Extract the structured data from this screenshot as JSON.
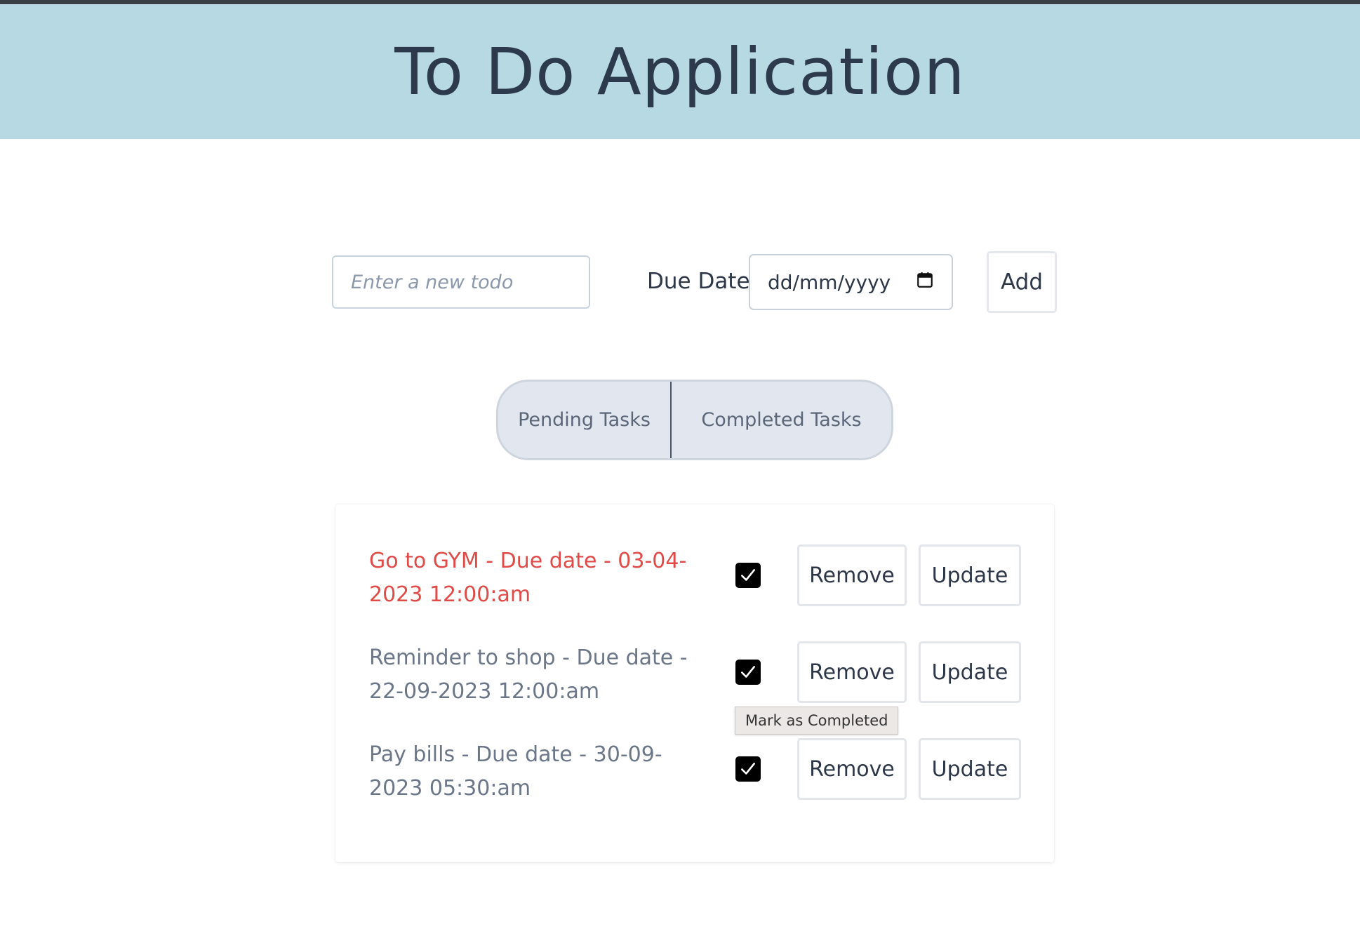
{
  "app": {
    "title": "To Do Application"
  },
  "form": {
    "todo_placeholder": "Enter a new todo",
    "todo_value": "",
    "due_label": "Due Date",
    "date_placeholder": "dd/mm/yyyy",
    "add_label": "Add"
  },
  "tabs": [
    {
      "label": "Pending Tasks",
      "active": true
    },
    {
      "label": "Completed Tasks",
      "active": false
    }
  ],
  "tasks": [
    {
      "text": "Go to GYM - Due date - 03-04-2023 12:00:am",
      "overdue": true,
      "checked": true,
      "remove_label": "Remove",
      "update_label": "Update"
    },
    {
      "text": "Reminder to shop - Due date - 22-09-2023 12:00:am",
      "overdue": false,
      "checked": true,
      "remove_label": "Remove",
      "update_label": "Update"
    },
    {
      "text": "Pay bills - Due date - 30-09-2023 05:30:am",
      "overdue": false,
      "checked": true,
      "remove_label": "Remove",
      "update_label": "Update"
    }
  ],
  "tooltip": {
    "text": "Mark as Completed"
  },
  "colors": {
    "header_bg": "#b7d9e3",
    "overdue_text": "#e04a47",
    "task_text": "#6b7788",
    "tab_bg": "#e2e7ef"
  },
  "icons": {
    "date": "calendar-icon",
    "check": "checkmark-icon"
  }
}
